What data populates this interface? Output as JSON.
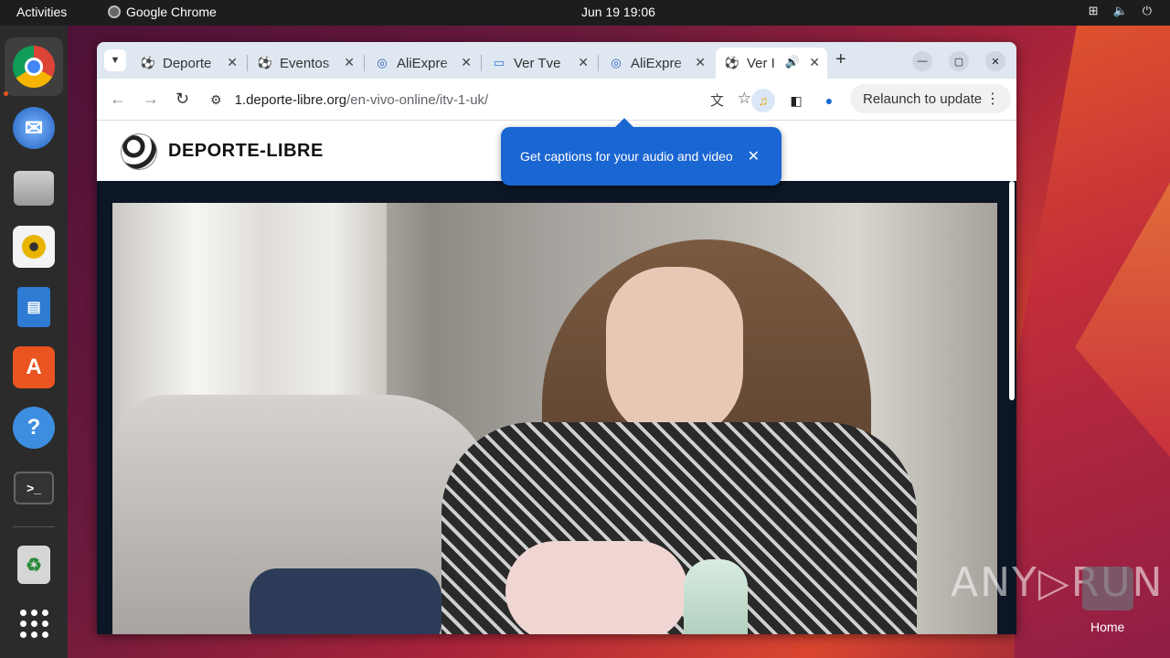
{
  "topbar": {
    "activities": "Activities",
    "app_name": "Google Chrome",
    "clock": "Jun 19  19:06"
  },
  "dock": {
    "items": [
      "chrome-icon",
      "thunderbird-icon",
      "files-icon",
      "rhythmbox-icon",
      "writer-icon",
      "app-center-icon",
      "help-icon",
      "terminal-icon",
      "trash-icon",
      "app-grid-icon"
    ]
  },
  "browser": {
    "tabs": [
      {
        "title": "Deporte",
        "favicon": "soccer-ball-icon"
      },
      {
        "title": "Eventos",
        "favicon": "soccer-ball-icon"
      },
      {
        "title": "AliExpre",
        "favicon": "aliexpress-icon"
      },
      {
        "title": "Ver Tve",
        "favicon": "tv-icon"
      },
      {
        "title": "AliExpre",
        "favicon": "aliexpress-icon"
      },
      {
        "title": "Ver I",
        "favicon": "soccer-ball-icon",
        "active": true
      }
    ],
    "url_host": "1.deporte-libre.org",
    "url_path": "/en-vivo-online/itv-1-uk/",
    "relaunch_label": "Relaunch to update"
  },
  "page": {
    "site_title": "DEPORTE-LIBRE",
    "caption_popup": "Get captions for your audio and video"
  },
  "watermark": "ANY▷RUN",
  "desktop": {
    "home_label": "Home"
  }
}
